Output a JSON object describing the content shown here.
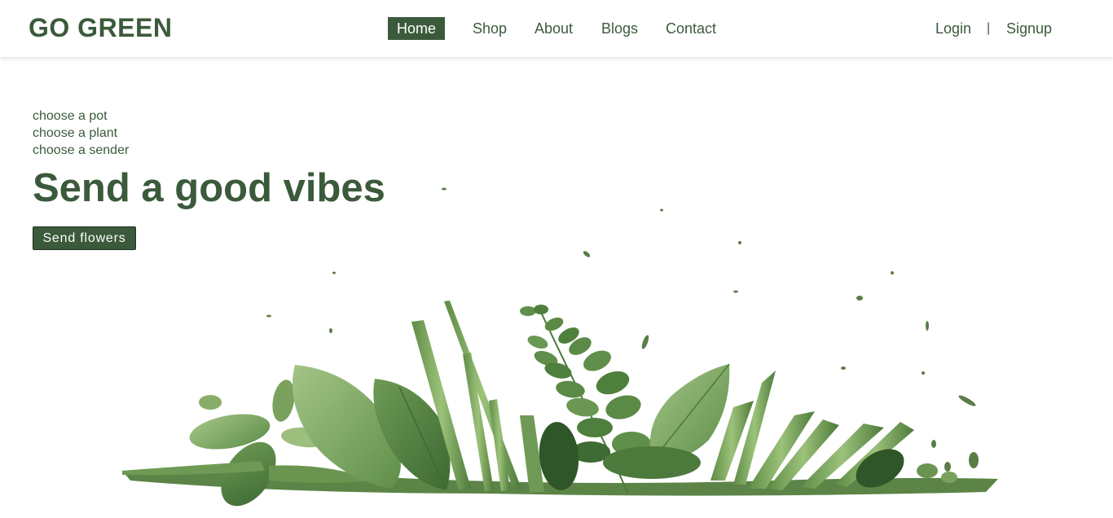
{
  "brand": {
    "name": "GO GREEN"
  },
  "nav": {
    "items": [
      {
        "label": "Home",
        "active": true
      },
      {
        "label": "Shop",
        "active": false
      },
      {
        "label": "About",
        "active": false
      },
      {
        "label": "Blogs",
        "active": false
      },
      {
        "label": "Contact",
        "active": false
      }
    ]
  },
  "auth": {
    "login": "Login",
    "separator": "|",
    "signup": "Signup"
  },
  "hero": {
    "steps": [
      "choose a pot",
      "choose a plant",
      "choose a sender"
    ],
    "headline": "Send a good vibes",
    "cta": "Send flowers",
    "image": "assorted-green-leaves-and-stems-arrangement"
  },
  "colors": {
    "primary": "#3b5a3b",
    "background": "#ffffff",
    "leaf_dark": "#4f7a3f",
    "leaf_light": "#8ab26a"
  }
}
